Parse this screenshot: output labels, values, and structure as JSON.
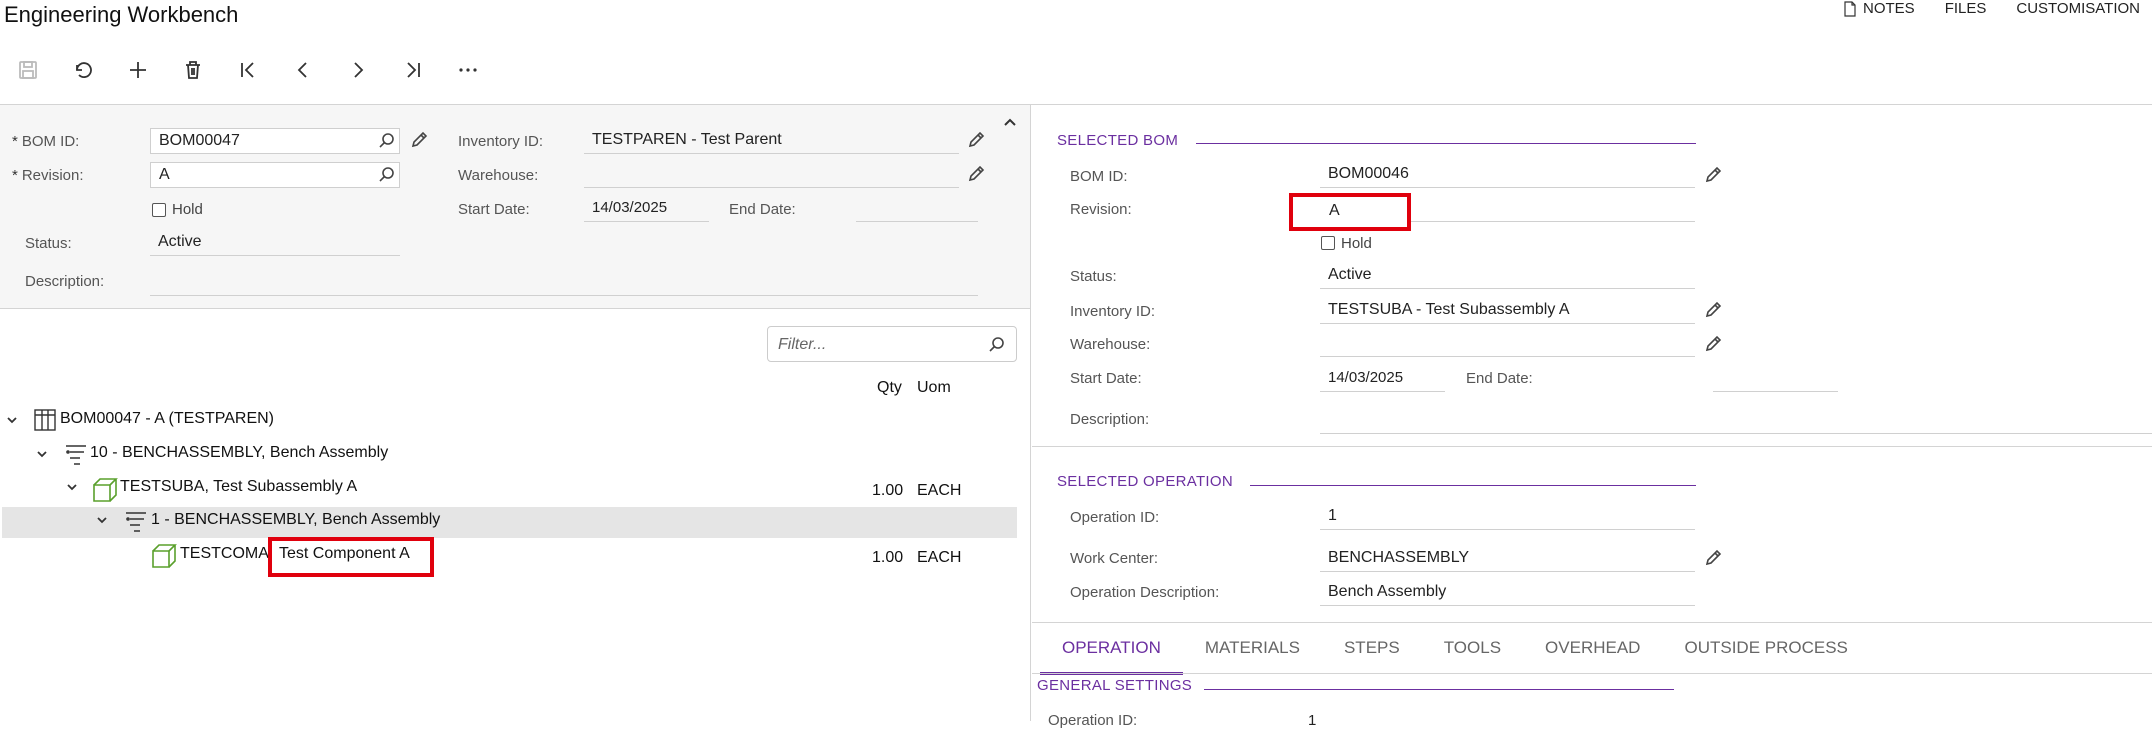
{
  "header": {
    "title": "Engineering Workbench"
  },
  "toplinks": {
    "notes": "NOTES",
    "files": "FILES",
    "customisation": "CUSTOMISATION"
  },
  "form": {
    "bom_id_label": "BOM ID:",
    "bom_id_value": "BOM00047",
    "revision_label": "Revision:",
    "revision_value": "A",
    "hold_label": "Hold",
    "status_label": "Status:",
    "status_value": "Active",
    "description_label": "Description:",
    "inventory_id_label": "Inventory ID:",
    "inventory_id_value": "TESTPAREN - Test Parent",
    "warehouse_label": "Warehouse:",
    "start_date_label": "Start Date:",
    "start_date_value": "14/03/2025",
    "end_date_label": "End Date:"
  },
  "tree": {
    "filter_placeholder": "Filter...",
    "col_qty": "Qty",
    "col_uom": "Uom",
    "rows": [
      {
        "label": "BOM00047 - A (TESTPAREN)",
        "qty": "",
        "uom": ""
      },
      {
        "label": "10 - BENCHASSEMBLY, Bench Assembly",
        "qty": "",
        "uom": ""
      },
      {
        "label": "TESTSUBA, Test Subassembly A",
        "qty": "1.00",
        "uom": "EACH"
      },
      {
        "label": "1 - BENCHASSEMBLY, Bench Assembly",
        "qty": "",
        "uom": ""
      },
      {
        "label_a": "TESTCOMA",
        "label_b": "Test Component A",
        "qty": "1.00",
        "uom": "EACH"
      }
    ]
  },
  "selected_bom": {
    "heading": "SELECTED BOM",
    "bom_id_label": "BOM ID:",
    "bom_id_value": "BOM00046",
    "revision_label": "Revision:",
    "revision_value": "A",
    "hold_label": "Hold",
    "status_label": "Status:",
    "status_value": "Active",
    "inventory_id_label": "Inventory ID:",
    "inventory_id_value": "TESTSUBA - Test Subassembly A",
    "warehouse_label": "Warehouse:",
    "start_date_label": "Start Date:",
    "start_date_value": "14/03/2025",
    "end_date_label": "End Date:",
    "description_label": "Description:"
  },
  "selected_operation": {
    "heading": "SELECTED OPERATION",
    "operation_id_label": "Operation ID:",
    "operation_id_value": "1",
    "work_center_label": "Work Center:",
    "work_center_value": "BENCHASSEMBLY",
    "op_desc_label": "Operation Description:",
    "op_desc_value": "Bench Assembly"
  },
  "tabs": [
    "OPERATION",
    "MATERIALS",
    "STEPS",
    "TOOLS",
    "OVERHEAD",
    "OUTSIDE PROCESS"
  ],
  "general_settings": {
    "heading": "GENERAL SETTINGS",
    "operation_id_label": "Operation ID:",
    "operation_id_value": "1"
  },
  "colors": {
    "accent": "#6b2fa0",
    "highlight": "#e0000d",
    "item_icon": "#5aa02c"
  }
}
